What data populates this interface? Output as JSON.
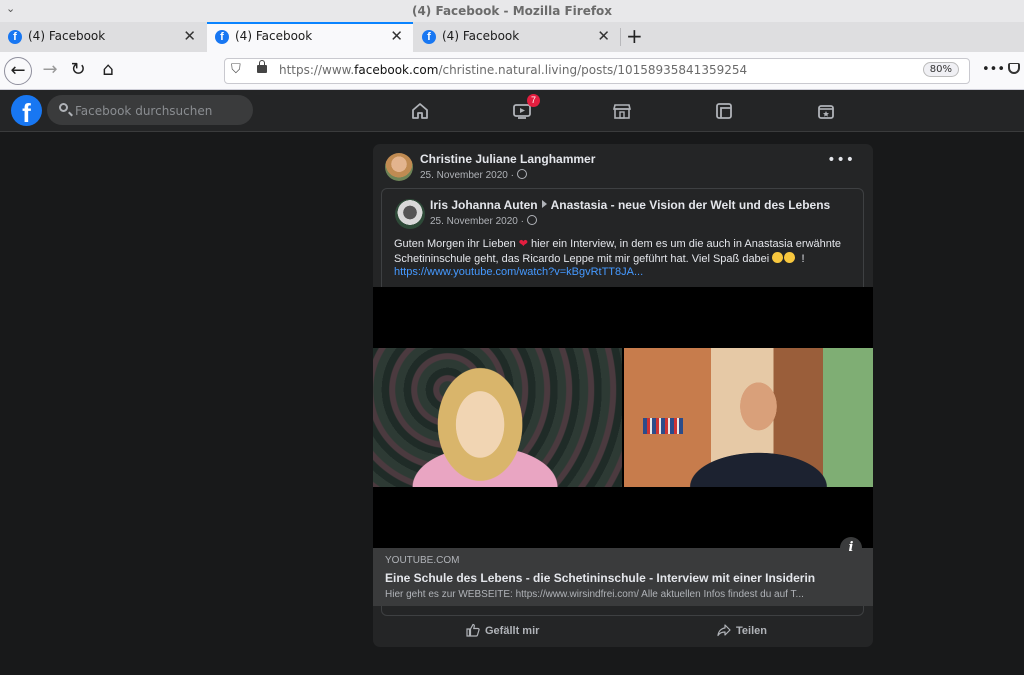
{
  "window": {
    "title": "(4) Facebook - Mozilla Firefox"
  },
  "tabs": [
    {
      "label": "(4) Facebook",
      "active": false
    },
    {
      "label": "(4) Facebook",
      "active": true
    },
    {
      "label": "(4) Facebook",
      "active": false
    }
  ],
  "urlbar": {
    "url_prefix": "https://www.",
    "url_domain": "facebook.com",
    "url_path": "/christine.natural.living/posts/10158935841359254",
    "zoom": "80%"
  },
  "fb_header": {
    "search_placeholder": "Facebook durchsuchen",
    "watch_badge": "7"
  },
  "post": {
    "author": "Christine Juliane Langhammer",
    "date": "25. November 2020 ·",
    "more": "•••",
    "shared": {
      "author": "Iris Johanna Auten",
      "target": "Anastasia - neue Vision der Welt und des Lebens",
      "date": "25. November 2020 ·",
      "text_part1": "Guten Morgen ihr Lieben",
      "text_part2": "hier ein Interview, in dem es um die auch in Anastasia erwähnte Schetininschule geht, das Ricardo Leppe mit mir geführt hat. Viel Spaß dabei",
      "text_end": "!",
      "link": "https://www.youtube.com/watch?v=kBgvRtTT8JA..."
    },
    "link_preview": {
      "domain": "YOUTUBE.COM",
      "title": "Eine Schule des Lebens - die Schetininschule - Interview mit einer Insiderin",
      "description": "Hier geht es zur WEBSEITE: https://www.wirsindfrei.com/ Alle aktuellen Infos findest du auf T..."
    },
    "actions": {
      "like": "Gefällt mir",
      "share": "Teilen"
    }
  },
  "colors": {
    "fb_blue": "#1877f2",
    "fb_bg": "#18191a",
    "card": "#242526",
    "link": "#4599ff",
    "badge": "#e41e3f"
  }
}
